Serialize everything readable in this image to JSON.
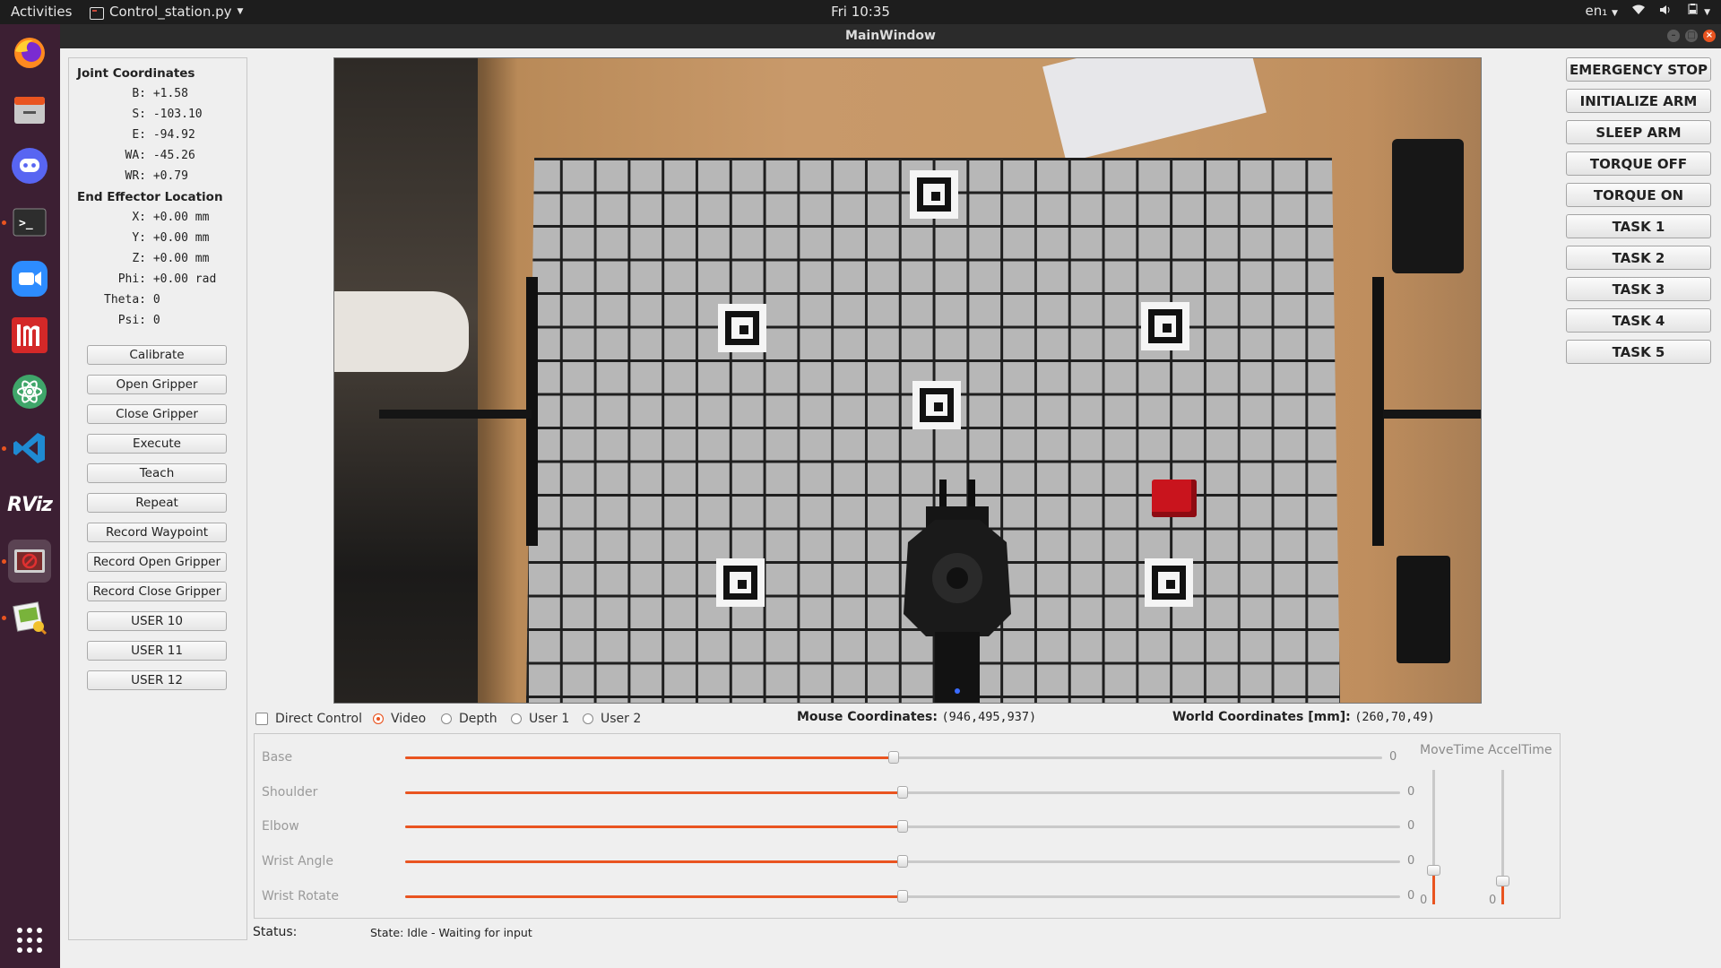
{
  "topbar": {
    "activities": "Activities",
    "app_menu": "Control_station.py",
    "clock": "Fri 10:35",
    "language": "en₁"
  },
  "dock": {
    "items": [
      {
        "icon": "firefox-icon"
      },
      {
        "icon": "file-manager-icon"
      },
      {
        "icon": "discord-icon"
      },
      {
        "icon": "terminal-icon"
      },
      {
        "icon": "zoom-icon"
      },
      {
        "icon": "imagemagick-icon"
      },
      {
        "icon": "atom-icon"
      },
      {
        "icon": "vscode-icon"
      },
      {
        "icon": "rviz-icon"
      },
      {
        "icon": "control-station-icon"
      },
      {
        "icon": "image-viewer-icon"
      },
      {
        "icon": "show-applications-icon"
      }
    ],
    "rviz_text": "RViz",
    "accent": "#e95420"
  },
  "window": {
    "title": "MainWindow"
  },
  "left_panel": {
    "joint_title": "Joint Coordinates",
    "joints": [
      {
        "label": "B:",
        "value": "+1.58"
      },
      {
        "label": "S:",
        "value": "-103.10"
      },
      {
        "label": "E:",
        "value": "-94.92"
      },
      {
        "label": "WA:",
        "value": "-45.26"
      },
      {
        "label": "WR:",
        "value": "+0.79"
      }
    ],
    "ee_title": "End Effector Location",
    "ee": [
      {
        "label": "X:",
        "value": "+0.00 mm"
      },
      {
        "label": "Y:",
        "value": "+0.00 mm"
      },
      {
        "label": "Z:",
        "value": "+0.00 mm"
      },
      {
        "label": "Phi:",
        "value": "+0.00 rad"
      }
    ],
    "angles": [
      {
        "label": "Theta:",
        "value": "0"
      },
      {
        "label": "Psi:",
        "value": "0"
      }
    ],
    "buttons": [
      "Calibrate",
      "Open Gripper",
      "Close Gripper",
      "Execute",
      "Teach",
      "Repeat",
      "Record Waypoint",
      "Record Open Gripper",
      "Record Close Gripper",
      "USER 10",
      "USER 11",
      "USER 12"
    ]
  },
  "right_buttons": [
    "EMERGENCY STOP",
    "INITIALIZE ARM",
    "SLEEP ARM",
    "TORQUE OFF",
    "TORQUE ON",
    "TASK 1",
    "TASK 2",
    "TASK 3",
    "TASK 4",
    "TASK 5"
  ],
  "view_options": {
    "direct_control": "Direct Control",
    "direct_control_checked": false,
    "radios": [
      {
        "label": "Video",
        "checked": true
      },
      {
        "label": "Depth",
        "checked": false
      },
      {
        "label": "User 1",
        "checked": false
      },
      {
        "label": "User 2",
        "checked": false
      }
    ]
  },
  "coords": {
    "mouse_label": "Mouse Coordinates:",
    "mouse_value": "(946,495,937)",
    "world_label": "World Coordinates [mm]:",
    "world_value": "(260,70,49)"
  },
  "sliders": [
    {
      "label": "Base",
      "value": "0",
      "fraction": 0.5
    },
    {
      "label": "Shoulder",
      "value": "0",
      "fraction": 0.5
    },
    {
      "label": "Elbow",
      "value": "0",
      "fraction": 0.5
    },
    {
      "label": "Wrist Angle",
      "value": "0",
      "fraction": 0.5
    },
    {
      "label": "Wrist Rotate",
      "value": "0",
      "fraction": 0.5
    }
  ],
  "vsliders": [
    {
      "label": "MoveTime",
      "value": "0",
      "fraction": 0.25
    },
    {
      "label": "AccelTime",
      "value": "0",
      "fraction": 0.17
    }
  ],
  "status": {
    "label": "Status:",
    "text": "State: Idle - Waiting for input"
  }
}
